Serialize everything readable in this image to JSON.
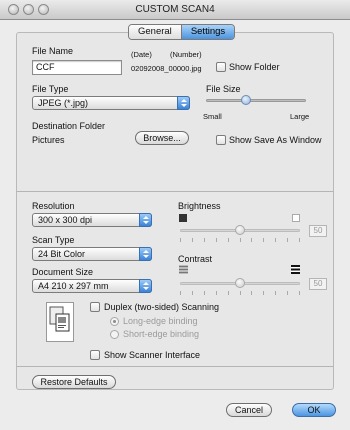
{
  "window": {
    "title": "CUSTOM SCAN4"
  },
  "tabs": [
    {
      "label": "General",
      "active": false
    },
    {
      "label": "Settings",
      "active": true
    }
  ],
  "file_name": {
    "label": "File Name",
    "value": "CCF",
    "date_header": "(Date)",
    "number_header": "(Number)",
    "preview": "02092008_00000.jpg",
    "show_folder_label": "Show Folder",
    "show_folder_checked": false
  },
  "file_type": {
    "label": "File Type",
    "value": "JPEG (*.jpg)"
  },
  "file_size": {
    "label": "File Size",
    "min_label": "Small",
    "max_label": "Large",
    "level": 0.4
  },
  "destination": {
    "label": "Destination Folder",
    "value": "Pictures",
    "browse_label": "Browse...",
    "show_save_as_label": "Show Save As Window",
    "show_save_as_checked": false
  },
  "resolution": {
    "label": "Resolution",
    "value": "300 x 300 dpi"
  },
  "scan_type": {
    "label": "Scan Type",
    "value": "24 Bit Color"
  },
  "document_size": {
    "label": "Document Size",
    "value": "A4  210 x 297 mm"
  },
  "brightness": {
    "label": "Brightness",
    "value": "50",
    "level": 0.5
  },
  "contrast": {
    "label": "Contrast",
    "value": "50",
    "level": 0.5
  },
  "duplex": {
    "label": "Duplex (two-sided) Scanning",
    "checked": false,
    "long_edge": "Long-edge binding",
    "short_edge": "Short-edge binding",
    "selected": "long_edge"
  },
  "show_scanner_interface": {
    "label": "Show Scanner Interface",
    "checked": false
  },
  "buttons": {
    "restore": "Restore Defaults",
    "cancel": "Cancel",
    "ok": "OK"
  },
  "colors": {
    "accent": "#4d93dc",
    "window_bg": "#ececec"
  }
}
